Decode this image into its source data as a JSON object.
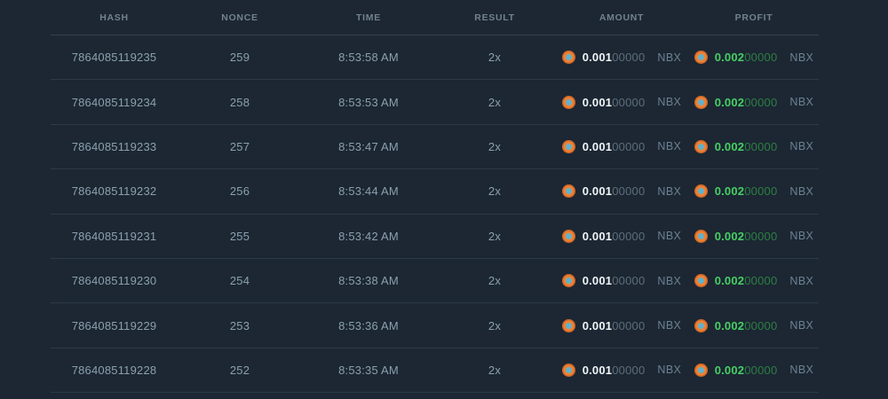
{
  "colors": {
    "background": "#1c2733",
    "divider": "#2c3a46",
    "header_divider": "#35434f",
    "header_text": "#72828e",
    "cell_text": "#8ba0ae",
    "amount_main": "#eff4f6",
    "amount_dim": "#5d6e7a",
    "currency_text": "#6c8191",
    "profit_main": "#47cf63",
    "profit_dim": "#2d7f43",
    "coin_outer": "#ee8235",
    "coin_inner": "#62b1cb"
  },
  "table": {
    "columns": [
      {
        "key": "hash",
        "label": "HASH"
      },
      {
        "key": "nonce",
        "label": "NONCE"
      },
      {
        "key": "time",
        "label": "TIME"
      },
      {
        "key": "result",
        "label": "RESULT"
      },
      {
        "key": "amount",
        "label": "AMOUNT"
      },
      {
        "key": "profit",
        "label": "PROFIT"
      }
    ],
    "currency": "NBX",
    "rows": [
      {
        "hash": "7864085119235",
        "nonce": "259",
        "time": "8:53:58 AM",
        "result": "2x",
        "amount": {
          "main": "0.001",
          "dim": "00000"
        },
        "profit": {
          "main": "0.002",
          "dim": "00000"
        }
      },
      {
        "hash": "7864085119234",
        "nonce": "258",
        "time": "8:53:53 AM",
        "result": "2x",
        "amount": {
          "main": "0.001",
          "dim": "00000"
        },
        "profit": {
          "main": "0.002",
          "dim": "00000"
        }
      },
      {
        "hash": "7864085119233",
        "nonce": "257",
        "time": "8:53:47 AM",
        "result": "2x",
        "amount": {
          "main": "0.001",
          "dim": "00000"
        },
        "profit": {
          "main": "0.002",
          "dim": "00000"
        }
      },
      {
        "hash": "7864085119232",
        "nonce": "256",
        "time": "8:53:44 AM",
        "result": "2x",
        "amount": {
          "main": "0.001",
          "dim": "00000"
        },
        "profit": {
          "main": "0.002",
          "dim": "00000"
        }
      },
      {
        "hash": "7864085119231",
        "nonce": "255",
        "time": "8:53:42 AM",
        "result": "2x",
        "amount": {
          "main": "0.001",
          "dim": "00000"
        },
        "profit": {
          "main": "0.002",
          "dim": "00000"
        }
      },
      {
        "hash": "7864085119230",
        "nonce": "254",
        "time": "8:53:38 AM",
        "result": "2x",
        "amount": {
          "main": "0.001",
          "dim": "00000"
        },
        "profit": {
          "main": "0.002",
          "dim": "00000"
        }
      },
      {
        "hash": "7864085119229",
        "nonce": "253",
        "time": "8:53:36 AM",
        "result": "2x",
        "amount": {
          "main": "0.001",
          "dim": "00000"
        },
        "profit": {
          "main": "0.002",
          "dim": "00000"
        }
      },
      {
        "hash": "7864085119228",
        "nonce": "252",
        "time": "8:53:35 AM",
        "result": "2x",
        "amount": {
          "main": "0.001",
          "dim": "00000"
        },
        "profit": {
          "main": "0.002",
          "dim": "00000"
        }
      }
    ]
  }
}
